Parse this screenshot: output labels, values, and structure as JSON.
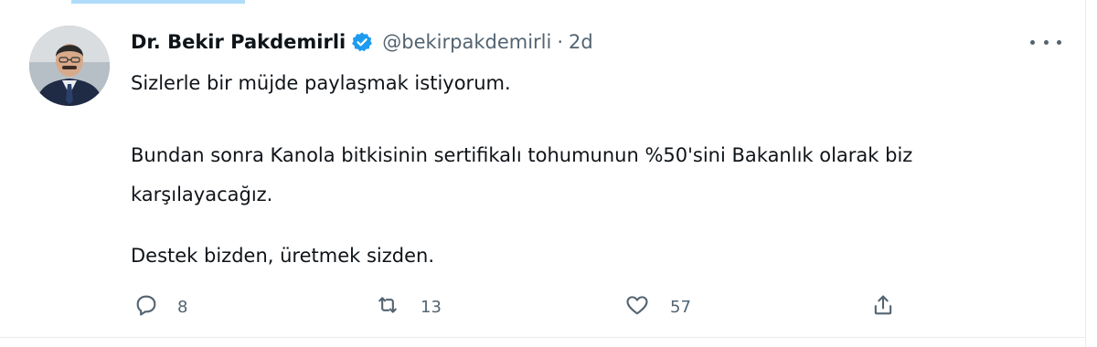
{
  "tweet": {
    "author_name": "Dr. Bekir Pakdemirli",
    "handle": "@bekirpakdemirli",
    "separator": "·",
    "time": "2d",
    "lines": [
      "Sizlerle bir müjde paylaşmak istiyorum.",
      "Bundan sonra Kanola bitkisinin sertifikalı tohumunun %50'sini Bakanlık olarak biz",
      "karşılayacağız.",
      "Destek bizden, üretmek sizden."
    ]
  },
  "actions": {
    "reply_count": "8",
    "retweet_count": "13",
    "like_count": "57"
  },
  "icons": {
    "verified": "verified-badge-icon",
    "reply": "reply-icon",
    "retweet": "retweet-icon",
    "like": "heart-icon",
    "share": "share-icon",
    "more": "more-icon"
  },
  "colors": {
    "accent": "#1d9bf0",
    "text": "#0f1419",
    "muted": "#536471"
  }
}
